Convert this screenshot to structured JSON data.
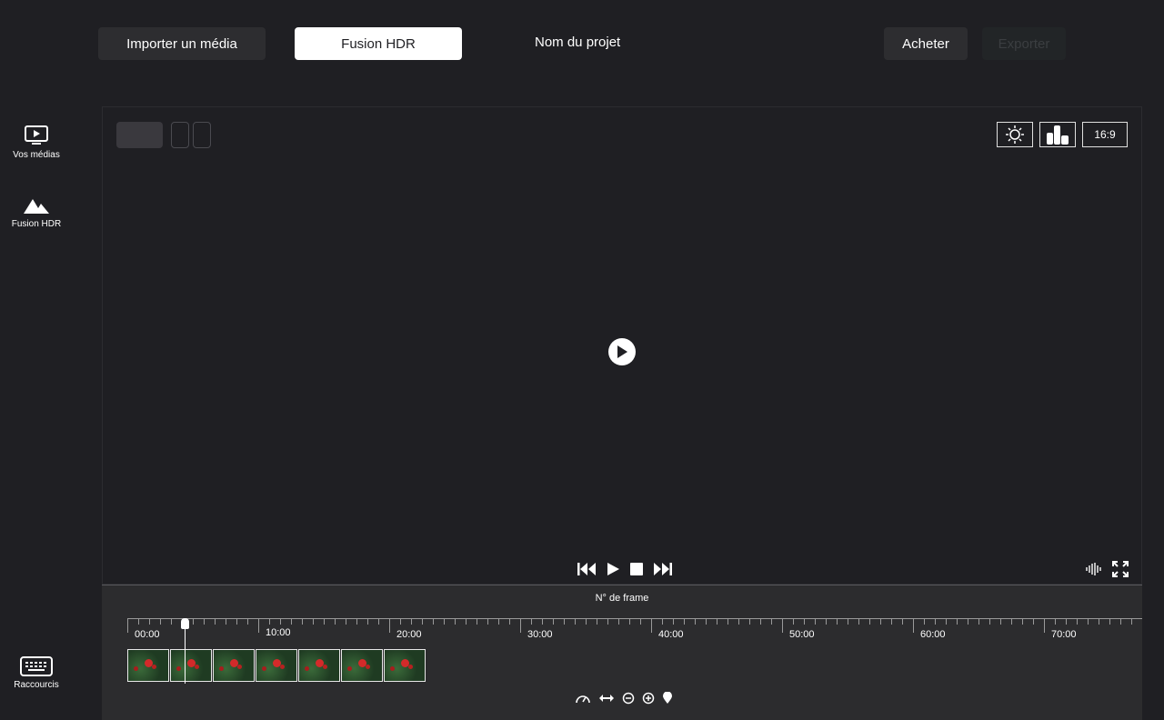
{
  "topbar": {
    "import_label": "Importer un média",
    "hdr_label": "Fusion HDR",
    "project_name": "Nom du projet",
    "buy_label": "Acheter",
    "export_label": "Exporter"
  },
  "sidebar": {
    "items": [
      {
        "label": "Vos médias",
        "icon": "monitor-play-icon"
      },
      {
        "label": "Fusion HDR",
        "icon": "mountain-icon"
      },
      {
        "label": "Raccourcis",
        "icon": "keyboard-icon"
      }
    ]
  },
  "viewer": {
    "aspect_label": "16:9",
    "tools": [
      "brightness-icon",
      "histogram-icon"
    ]
  },
  "timeline": {
    "title": "N° de frame",
    "labels": [
      "00:00",
      "10:00",
      "20:00",
      "30:00",
      "40:00",
      "50:00",
      "60:00",
      "70:00"
    ],
    "clip_count": 7,
    "tools": [
      "speed-icon",
      "fit-width-icon",
      "zoom-out-icon",
      "zoom-in-icon",
      "marker-icon"
    ]
  },
  "colors": {
    "background": "#1f1f23",
    "panel": "#2c2c2e",
    "button_dark": "#2d2d30",
    "button_light": "#ffffff"
  }
}
